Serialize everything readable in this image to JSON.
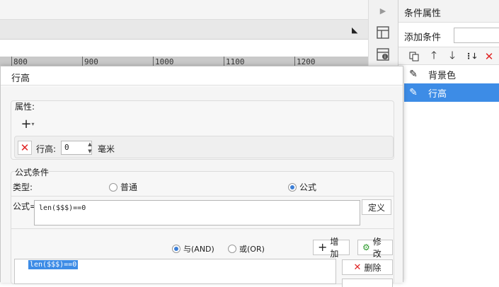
{
  "ruler": {
    "ticks": [
      "800",
      "900",
      "1000",
      "1100",
      "1200"
    ]
  },
  "right_panel": {
    "title": "条件属性",
    "add_condition_label": "添加条件",
    "add_condition_value": "",
    "toolbar_icons": [
      "copy-icon",
      "arrow-up-icon",
      "arrow-down-icon",
      "sort-down-icon",
      "delete-icon"
    ],
    "conditions": [
      {
        "label": "背景色",
        "icon": "pencil-icon",
        "selected": false
      },
      {
        "label": "行高",
        "icon": "pencil-icon",
        "selected": true
      }
    ]
  },
  "dialog": {
    "title": "行高",
    "property": {
      "label": "属性:",
      "row_label": "行高:",
      "row_value": "0",
      "unit": "毫米"
    },
    "formula_condition": {
      "section_label": "公式条件",
      "type_label": "类型:",
      "type_options": [
        "普通",
        "公式"
      ],
      "type_selected": "公式",
      "formula_label": "公式=",
      "formula_value": "len($$$)==0",
      "define_button": "定义",
      "logic_options": [
        "与(AND)",
        "或(OR)"
      ],
      "logic_selected": "与(AND)",
      "add_button": "增加",
      "modify_button": "修改",
      "delete_button": "删除",
      "conditions_list": [
        "len($$$)==0"
      ]
    }
  },
  "colors": {
    "selection": "#3d8ce6",
    "delete_red": "#e02424",
    "radio_blue": "#3d7fd6"
  }
}
